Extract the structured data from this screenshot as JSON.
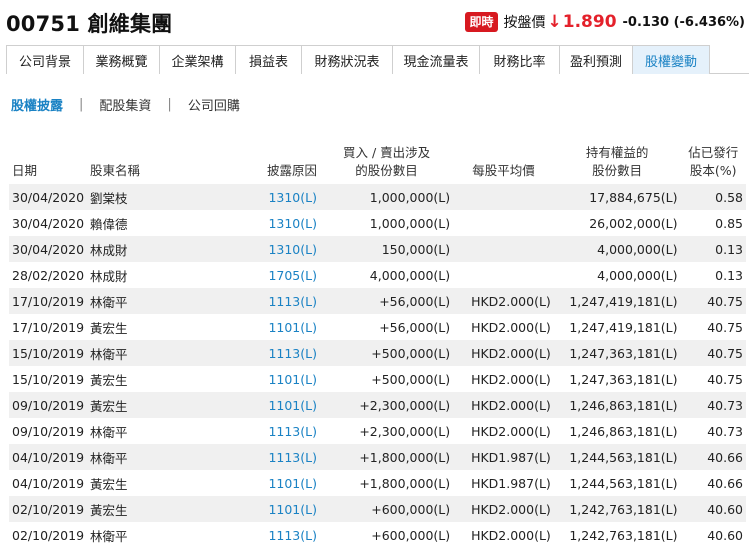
{
  "header": {
    "title": "00751 創維集團",
    "live_badge": "即時",
    "quote_label": "按盤價",
    "arrow": "↓",
    "price": "1.890",
    "change": "-0.130 (-6.436%)",
    "colors": {
      "down": "#e4212b",
      "badge": "#d71920",
      "link": "#1a82c4",
      "active_tab_bg": "#e5f1fb"
    }
  },
  "tabs": [
    {
      "label": "公司背景",
      "active": false
    },
    {
      "label": "業務概覽",
      "active": false
    },
    {
      "label": "企業架構",
      "active": false
    },
    {
      "label": "損益表",
      "active": false
    },
    {
      "label": "財務狀況表",
      "active": false
    },
    {
      "label": "現金流量表",
      "active": false
    },
    {
      "label": "財務比率",
      "active": false
    },
    {
      "label": "盈利預測",
      "active": false
    },
    {
      "label": "股權變動",
      "active": true
    }
  ],
  "subnav": [
    {
      "label": "股權披露",
      "active": true
    },
    {
      "label": "配股集資",
      "active": false
    },
    {
      "label": "公司回購",
      "active": false
    }
  ],
  "subnav_separator": "|",
  "table": {
    "headers": {
      "date": "日期",
      "name": "股東名稱",
      "reason": "披露原因",
      "shares_l1": "買入 / 賣出涉及",
      "shares_l2": "的股份數目",
      "avg_price": "每股平均價",
      "holding_l1": "持有權益的",
      "holding_l2": "股份數目",
      "pct_l1": "佔已發行",
      "pct_l2": "股本(%)"
    },
    "rows": [
      {
        "date": "30/04/2020",
        "name": "劉棠枝",
        "reason": "1310(L)",
        "shares": "1,000,000(L)",
        "avg": "",
        "holding": "17,884,675(L)",
        "pct": "0.58"
      },
      {
        "date": "30/04/2020",
        "name": "賴偉德",
        "reason": "1310(L)",
        "shares": "1,000,000(L)",
        "avg": "",
        "holding": "26,002,000(L)",
        "pct": "0.85"
      },
      {
        "date": "30/04/2020",
        "name": "林成財",
        "reason": "1310(L)",
        "shares": "150,000(L)",
        "avg": "",
        "holding": "4,000,000(L)",
        "pct": "0.13"
      },
      {
        "date": "28/02/2020",
        "name": "林成財",
        "reason": "1705(L)",
        "shares": "4,000,000(L)",
        "avg": "",
        "holding": "4,000,000(L)",
        "pct": "0.13"
      },
      {
        "date": "17/10/2019",
        "name": "林衛平",
        "reason": "1113(L)",
        "shares": "+56,000(L)",
        "avg": "HKD2.000(L)",
        "holding": "1,247,419,181(L)",
        "pct": "40.75"
      },
      {
        "date": "17/10/2019",
        "name": "黃宏生",
        "reason": "1101(L)",
        "shares": "+56,000(L)",
        "avg": "HKD2.000(L)",
        "holding": "1,247,419,181(L)",
        "pct": "40.75"
      },
      {
        "date": "15/10/2019",
        "name": "林衛平",
        "reason": "1113(L)",
        "shares": "+500,000(L)",
        "avg": "HKD2.000(L)",
        "holding": "1,247,363,181(L)",
        "pct": "40.75"
      },
      {
        "date": "15/10/2019",
        "name": "黃宏生",
        "reason": "1101(L)",
        "shares": "+500,000(L)",
        "avg": "HKD2.000(L)",
        "holding": "1,247,363,181(L)",
        "pct": "40.75"
      },
      {
        "date": "09/10/2019",
        "name": "黃宏生",
        "reason": "1101(L)",
        "shares": "+2,300,000(L)",
        "avg": "HKD2.000(L)",
        "holding": "1,246,863,181(L)",
        "pct": "40.73"
      },
      {
        "date": "09/10/2019",
        "name": "林衛平",
        "reason": "1113(L)",
        "shares": "+2,300,000(L)",
        "avg": "HKD2.000(L)",
        "holding": "1,246,863,181(L)",
        "pct": "40.73"
      },
      {
        "date": "04/10/2019",
        "name": "林衛平",
        "reason": "1113(L)",
        "shares": "+1,800,000(L)",
        "avg": "HKD1.987(L)",
        "holding": "1,244,563,181(L)",
        "pct": "40.66"
      },
      {
        "date": "04/10/2019",
        "name": "黃宏生",
        "reason": "1101(L)",
        "shares": "+1,800,000(L)",
        "avg": "HKD1.987(L)",
        "holding": "1,244,563,181(L)",
        "pct": "40.66"
      },
      {
        "date": "02/10/2019",
        "name": "黃宏生",
        "reason": "1101(L)",
        "shares": "+600,000(L)",
        "avg": "HKD2.000(L)",
        "holding": "1,242,763,181(L)",
        "pct": "40.60"
      },
      {
        "date": "02/10/2019",
        "name": "林衛平",
        "reason": "1113(L)",
        "shares": "+600,000(L)",
        "avg": "HKD2.000(L)",
        "holding": "1,242,763,181(L)",
        "pct": "40.60"
      }
    ]
  }
}
